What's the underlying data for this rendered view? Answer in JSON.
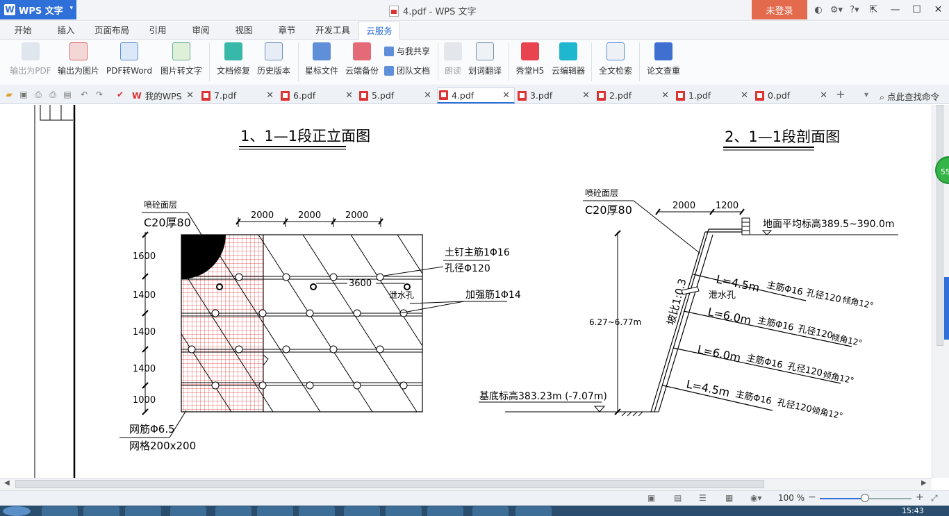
{
  "app": {
    "name": "WPS 文字",
    "window_title": "4.pdf - WPS 文字",
    "login": "未登录"
  },
  "title_icons": [
    "skin-icon",
    "settings-icon",
    "help-icon",
    "menu-icon"
  ],
  "menu": [
    "开始",
    "插入",
    "页面布局",
    "引用",
    "审阅",
    "视图",
    "章节",
    "开发工具",
    "云服务"
  ],
  "ribbon": {
    "buttons": [
      "输出为PDF",
      "输出为图片",
      "PDF转Word",
      "图片转文字",
      "文档修复",
      "历史版本",
      "星标文件",
      "云端备份",
      "朗读",
      "划词翻译",
      "秀堂H5",
      "云编辑器",
      "全文检索",
      "论文查重"
    ],
    "small": [
      "与我共享",
      "团队文档"
    ]
  },
  "tabs": [
    "我的WPS",
    "7.pdf",
    "6.pdf",
    "5.pdf",
    "4.pdf",
    "3.pdf",
    "2.pdf",
    "1.pdf",
    "0.pdf"
  ],
  "find_command": "点此查找命令",
  "badge": "55",
  "status": {
    "zoom": "100 %"
  },
  "clock": "15:43",
  "drawing": {
    "left": {
      "title": "1、1—1段正立面图",
      "shotcrete_label": "喷砼面层",
      "shotcrete_spec": "C20厚80",
      "dims_top": [
        "2000",
        "2000",
        "2000"
      ],
      "dims_left": [
        "1600",
        "1400",
        "1400",
        "1400",
        "1000"
      ],
      "nail_label": "土钉主筋1Φ16",
      "hole_label": "孔径Φ120",
      "spacing": "3600",
      "drain_label": "泄水孔",
      "rebar_label": "加强筋1Φ14",
      "mesh_label": "网筋Φ6.5",
      "mesh_grid": "网格200x200"
    },
    "right": {
      "title": "2、1—1段剖面图",
      "shotcrete_label": "喷砼面层",
      "shotcrete_spec": "C20厚80",
      "dims_top": [
        "2000",
        "1200"
      ],
      "ground_label": "地面平均标高389.5~390.0m",
      "height_label": "6.27~6.77m",
      "slope_label": "坡比1:0.3",
      "drain_label": "泄水孔",
      "base_label": "基底标高383.23m (-7.07m)",
      "nails": [
        {
          "len": "L=4.5m",
          "bar": "主筋Φ16",
          "hole": "孔径120",
          "angle": "倾角12°"
        },
        {
          "len": "L=6.0m",
          "bar": "主筋Φ16",
          "hole": "孔径120",
          "angle": "倾角12°"
        },
        {
          "len": "L=6.0m",
          "bar": "主筋Φ16",
          "hole": "孔径120",
          "angle": "倾角12°"
        },
        {
          "len": "L=4.5m",
          "bar": "主筋Φ16",
          "hole": "孔径120",
          "angle": "倾角12°"
        }
      ]
    }
  }
}
